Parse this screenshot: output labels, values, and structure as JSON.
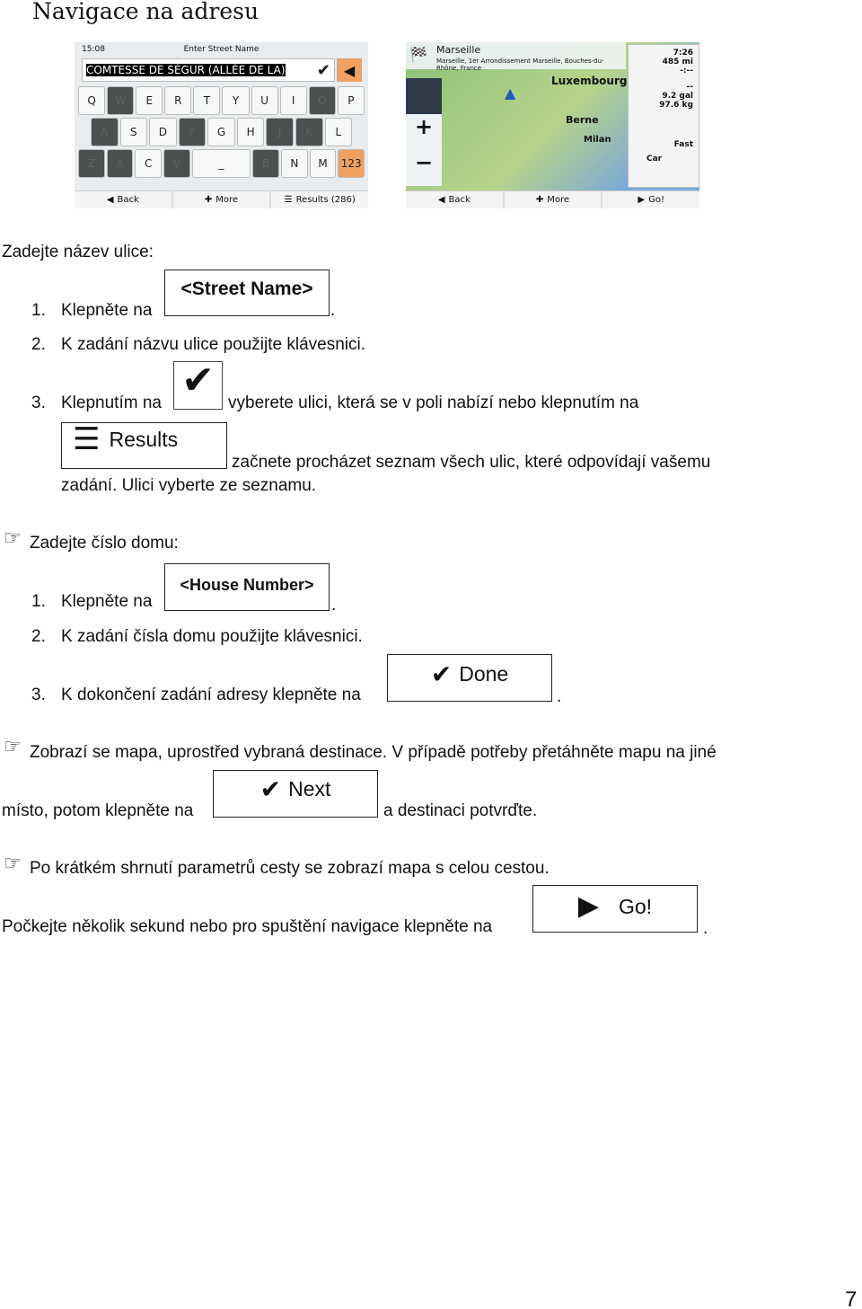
{
  "title": "Navigace na adresu",
  "keyboard_shot": {
    "time": "15:08",
    "header": "Enter Street Name",
    "input_value": "COMTESSE DE SÉGUR (ALLÉE DE LA)",
    "rows": [
      [
        "Q",
        "W",
        "E",
        "R",
        "T",
        "Y",
        "U",
        "I",
        "O",
        "P"
      ],
      [
        "A",
        "S",
        "D",
        "F",
        "G",
        "H",
        "J",
        "K",
        "L"
      ],
      [
        "Z",
        "X",
        "C",
        "V",
        "_",
        "B",
        "N",
        "M",
        "123"
      ]
    ],
    "disabled_keys": [
      "W",
      "O",
      "A",
      "F",
      "J",
      "K",
      "Z",
      "X",
      "V",
      "B"
    ],
    "back": "Back",
    "more": "More",
    "results": "Results (286)",
    "accent": "#f0a060"
  },
  "map_shot": {
    "dest_title": "Marseille",
    "dest_sub": "Marseille, 1er Arrondissement Marseille, Bouches-du-Rhône, France",
    "cities": [
      "Luxembourg",
      "Berne",
      "Milan"
    ],
    "time": "7:26",
    "distance": "485 mi",
    "eta": "-:--",
    "cost": "--",
    "fuel": "9.2 gal",
    "co2": "97.6 kg",
    "route_type": "Fast",
    "vehicle": "Car",
    "back": "Back",
    "more": "More",
    "go": "Go!"
  },
  "s1": {
    "heading": "Zadejte název ulice:",
    "i1_num": "1.",
    "i1_text": "Klepněte na",
    "i1_button": "<Street Name>",
    "i1_end": ".",
    "i2_num": "2.",
    "i2_text": "K zadání názvu ulice použijte klávesnici.",
    "i3_num": "3.",
    "i3_text": "Klepnutím na",
    "i3_after": "vyberete ulici, která se v poli nabízí nebo klepnutím na",
    "results_button": "Results",
    "i3_cont": "začnete procházet seznam všech ulic, které odpovídají vašemu",
    "i3_cont2": "zadání. Ulici vyberte ze seznamu."
  },
  "s2": {
    "heading": "Zadejte číslo domu:",
    "i1_num": "1.",
    "i1_text": "Klepněte na",
    "i1_button": "<House Number>",
    "i1_end": ".",
    "i2_num": "2.",
    "i2_text": "K zadání čísla domu použijte klávesnici.",
    "i3_num": "3.",
    "i3_text": "K dokončení zadání adresy klepněte na",
    "done_button": "Done",
    "i3_end": "."
  },
  "s3": {
    "line1": "Zobrazí se mapa, uprostřed vybraná destinace. V případě potřeby přetáhněte mapu na jiné",
    "line2": "místo, potom klepněte na",
    "next_button": "Next",
    "line2_end": "a destinaci potvrďte."
  },
  "s4": {
    "line1": "Po krátkém shrnutí parametrů cesty se zobrazí mapa s celou cestou.",
    "line2": "Počkejte několik sekund nebo pro spuštění navigace klepněte na",
    "go_button": "Go!",
    "end": "."
  },
  "page_number": "7"
}
